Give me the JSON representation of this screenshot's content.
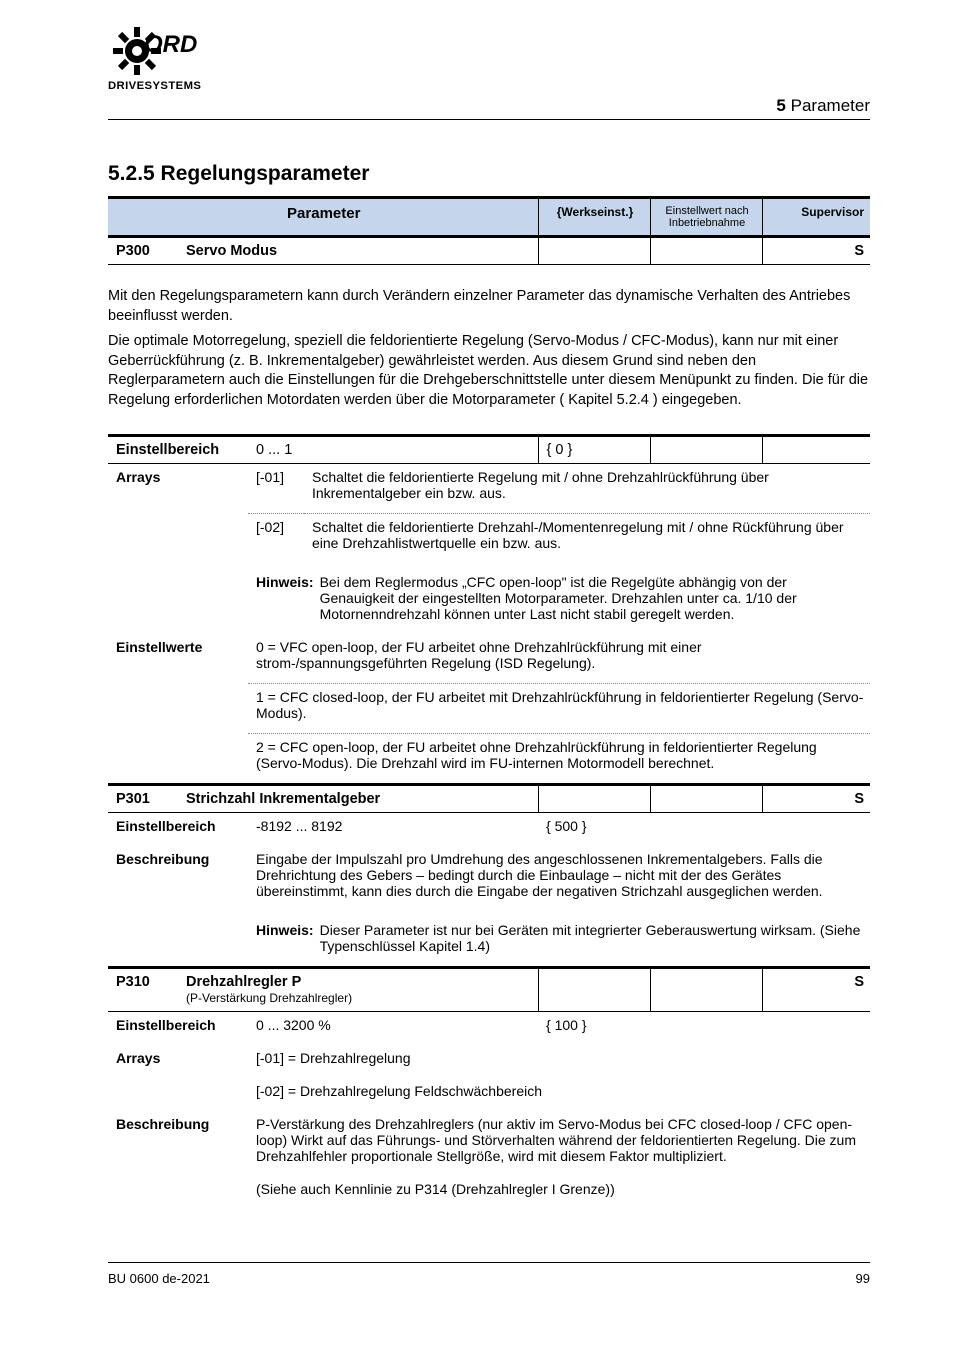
{
  "header": {
    "section_num": "5",
    "section_title": "Parameter"
  },
  "main_heading": "5.2.5 Regelungsparameter",
  "strip": {
    "col1_label": "Parameter",
    "col2_label": "{Werkseinst.}",
    "col3_label": "Einstellwert nach Inbetriebnahme",
    "col4_label": "Supervisor"
  },
  "intro": {
    "p1": "Mit den Regelungsparametern kann durch Verändern einzelner Parameter das dynamische Verhalten des Antriebes beeinflusst werden.",
    "p2_a": "Die optimale Motorregelung, speziell die feldorientierte Regelung (Servo-Modus / CFC-Modus), kann nur mit einer Geberrückführung (z. B. Inkrementalgeber) gewährleistet werden. Aus diesem Grund sind neben den Reglerparametern auch die Einstellungen für die Drehgeberschnittstelle unter diesem Menüpunkt zu finden. Die für die Regelung erforderlichen Motordaten werden über die Motorparameter (",
    "p2_link": "Kapitel 5.2.4",
    "p2_b": ") eingegeben."
  },
  "p300": {
    "code": "P300",
    "title": "Servo Modus",
    "super": "S",
    "unit_col2": "0 ... 1",
    "default": "{ 0 }",
    "label": "Einstellbereich",
    "row3_label": "Arrays",
    "row3_val": "[-01]",
    "row3_text": "Schaltet die feldorientierte Regelung mit / ohne Drehzahlrückführung über Inkrementalgeber ein bzw. aus.",
    "row4_val": "[-02]",
    "row4_text": "Schaltet die feldorientierte Drehzahl-/Momentenregelung mit / ohne Rückführung über eine Drehzahlistwertquelle ein bzw. aus.",
    "note_tag": "Hinweis:",
    "note_text": "Bei dem Reglermodus „CFC open-loop\" ist die Regelgüte abhängig von der Genauigkeit der eingestellten Motorparameter. Drehzahlen unter ca. 1/10 der Motornenndrehzahl können unter Last nicht stabil geregelt werden.",
    "values_label": "Einstellwerte",
    "opt0": "0 = VFC open-loop, der FU arbeitet ohne Drehzahlrückführung mit einer strom-/spannungsgeführten Regelung (ISD Regelung).",
    "opt1": "1 = CFC closed-loop, der FU arbeitet mit Drehzahlrückführung in feldorientierter Regelung (Servo-Modus).",
    "opt2": "2 = CFC open-loop, der FU arbeitet ohne Drehzahlrückführung in feldorientierter Regelung (Servo-Modus). Die Drehzahl wird im FU-internen Motormodell berechnet."
  },
  "p301": {
    "code": "P301",
    "title": "Strichzahl Inkrementalgeber",
    "super": "S",
    "label": "Einstellbereich",
    "range": "-8192 ... 8192",
    "default": "{ 500 }",
    "body_label": "Beschreibung",
    "body": "Eingabe der Impulszahl pro Umdrehung des angeschlossenen Inkrementalgebers. Falls die Drehrichtung des Gebers – bedingt durch die Einbaulage – nicht mit der des Gerätes übereinstimmt, kann dies durch die Eingabe der negativen Strichzahl ausgeglichen werden.",
    "note_tag": "Hinweis:",
    "note_text": "Dieser Parameter ist nur bei Geräten mit integrierter Geberauswertung wirksam. (Siehe Typenschlüssel Kapitel 1.4)"
  },
  "p310": {
    "code": "P310",
    "title": "Drehzahlregler P",
    "super": "S",
    "sub": "(P-Verstärkung Drehzahlregler)",
    "label": "Einstellbereich",
    "range": "0 ... 3200 %",
    "default": "{ 100 }",
    "row2_label": "Arrays",
    "row2_val": "[-01] = Drehzahlregelung",
    "row3_val": "[-02] = Drehzahlregelung Feldschwächbereich",
    "body_label": "Beschreibung",
    "body": "P-Verstärkung des Drehzahlreglers (nur aktiv im Servo-Modus bei CFC closed-loop / CFC open-loop) Wirkt auf das Führungs- und Störverhalten während der feldorientierten Regelung. Die zum Drehzahlfehler proportionale Stellgröße, wird mit diesem Faktor multipliziert.",
    "chart_caption": "(Siehe auch Kennlinie zu P314 (Drehzahlregler I Grenze))"
  },
  "footer": {
    "left": "BU 0600 de-2021",
    "right": "99"
  }
}
